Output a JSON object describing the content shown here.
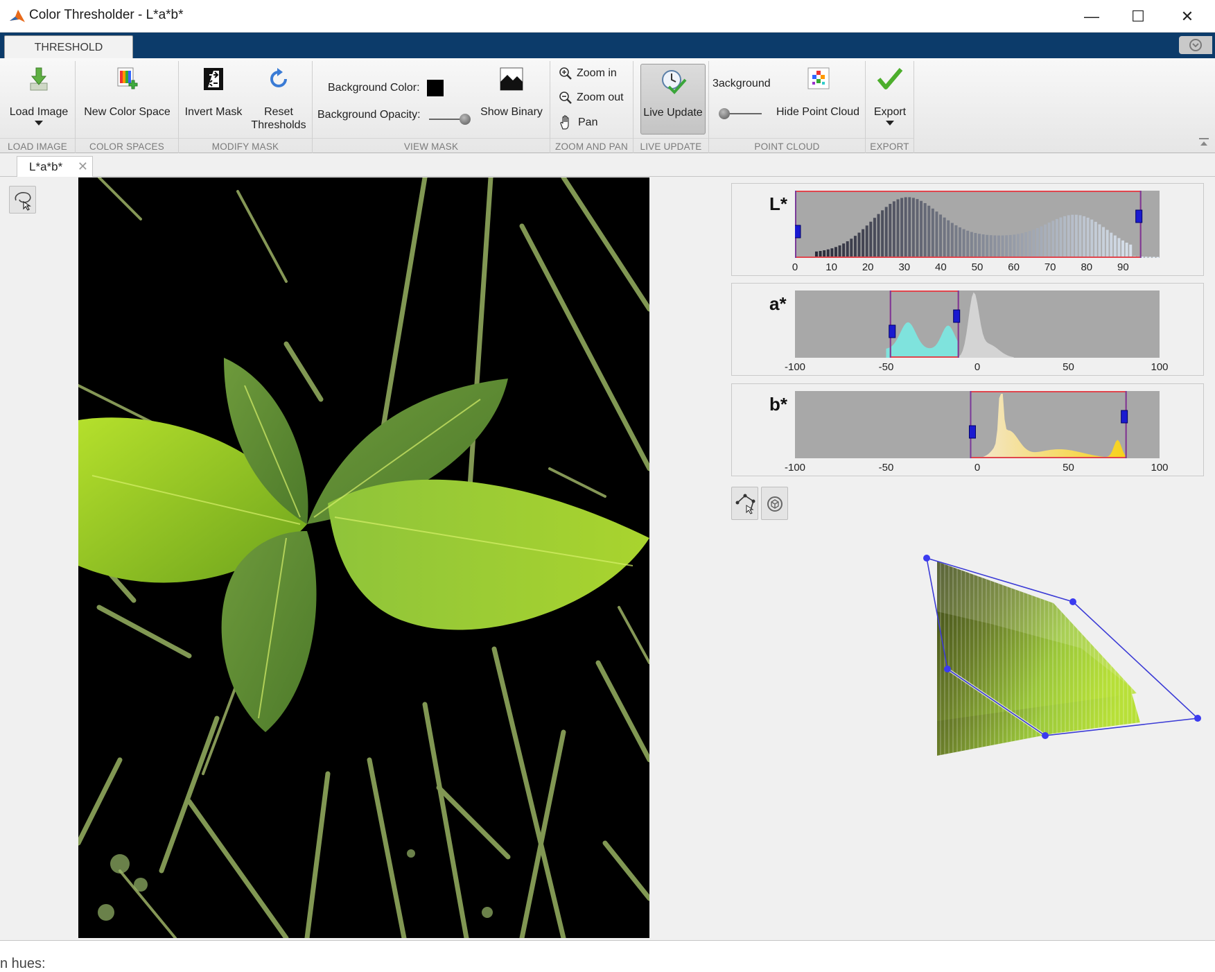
{
  "window": {
    "title": "Color Thresholder - L*a*b*",
    "minimize_label": "—",
    "maximize_label": "☐",
    "close_label": "✕"
  },
  "ribbon": {
    "tab": "THRESHOLD",
    "load_image": {
      "label": "Load Image",
      "section": "LOAD IMAGE"
    },
    "color_spaces": {
      "label": "New Color Space",
      "section": "COLOR SPACES"
    },
    "modify_mask": {
      "invert_label": "Invert Mask",
      "reset_label_1": "Reset",
      "reset_label_2": "Thresholds",
      "section": "MODIFY MASK"
    },
    "view_mask": {
      "bg_color_label": "Background Color:",
      "bg_opacity_label": "Background Opacity:",
      "show_binary_label": "Show Binary",
      "section": "VIEW MASK",
      "bg_color": "#000000"
    },
    "zoom_pan": {
      "zoom_in": "Zoom in",
      "zoom_out": "Zoom out",
      "pan": "Pan",
      "section": "ZOOM AND PAN"
    },
    "live_update": {
      "label": "Live Update",
      "section": "LIVE UPDATE"
    },
    "point_cloud": {
      "background_label": "3ackground",
      "hide_label": "Hide Point Cloud",
      "section": "POINT CLOUD"
    },
    "export": {
      "label": "Export",
      "section": "EXPORT"
    }
  },
  "document": {
    "tab_label": "L*a*b*",
    "close_label": "✕"
  },
  "histograms": [
    {
      "channel": "L*",
      "ticks": [
        "0",
        "10",
        "20",
        "30",
        "40",
        "50",
        "60",
        "70",
        "80",
        "90"
      ],
      "range": [
        0,
        100
      ],
      "selection": [
        0,
        95
      ]
    },
    {
      "channel": "a*",
      "ticks": [
        "-100",
        "-50",
        "0",
        "50",
        "100"
      ],
      "range": [
        -100,
        100
      ],
      "selection": [
        -48,
        -10
      ]
    },
    {
      "channel": "b*",
      "ticks": [
        "-100",
        "-50",
        "0",
        "50",
        "100"
      ],
      "range": [
        -100,
        100
      ],
      "selection": [
        -4,
        82
      ]
    }
  ],
  "bottom_text": "n hues:",
  "colors": {
    "accent_dark": "#0c3b6a",
    "selection_red": "#e0454d",
    "handle_blue": "#1a1ad0",
    "hist_bg": "#a8a8a8"
  }
}
